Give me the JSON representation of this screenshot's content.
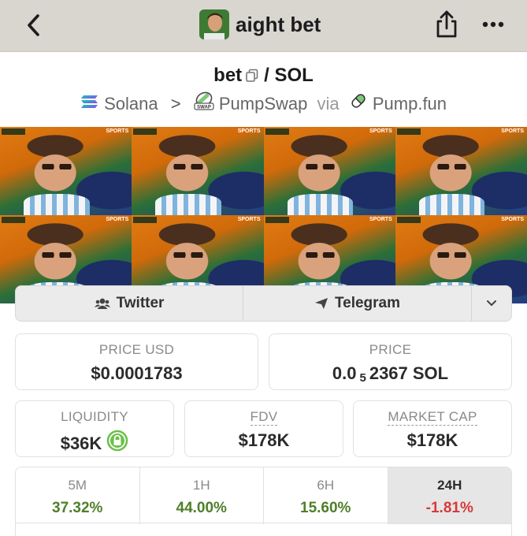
{
  "header": {
    "title": "aight bet",
    "icons": {
      "back": "chevron-left-icon",
      "share": "share-icon",
      "more": "ellipsis-icon"
    }
  },
  "pair": {
    "base": "bet",
    "separator": "/",
    "quote": "SOL"
  },
  "chain": {
    "network": "Solana",
    "dex": "PumpSwap",
    "via_label": "via",
    "launchpad": "Pump.fun"
  },
  "links": {
    "twitter": "Twitter",
    "telegram": "Telegram"
  },
  "stats": {
    "price_usd": {
      "label": "PRICE USD",
      "value": "$0.0001783"
    },
    "price": {
      "label": "PRICE",
      "value_prefix": "0.0",
      "value_subscript": "5",
      "value_suffix": "2367 SOL"
    },
    "liquidity": {
      "label": "LIQUIDITY",
      "value": "$36K"
    },
    "fdv": {
      "label": "FDV",
      "value": "$178K"
    },
    "market_cap": {
      "label": "MARKET CAP",
      "value": "$178K"
    }
  },
  "timeframes": [
    {
      "label": "5M",
      "change": "37.32%"
    },
    {
      "label": "1H",
      "change": "44.00%"
    },
    {
      "label": "6H",
      "change": "15.60%"
    },
    {
      "label": "24H",
      "change": "-1.81%",
      "active": true
    }
  ],
  "colors": {
    "positive": "#4f7f2a",
    "negative": "#d63a3a",
    "topbar_bg": "#d9d6cf",
    "lock_badge": "#6cc04a"
  }
}
